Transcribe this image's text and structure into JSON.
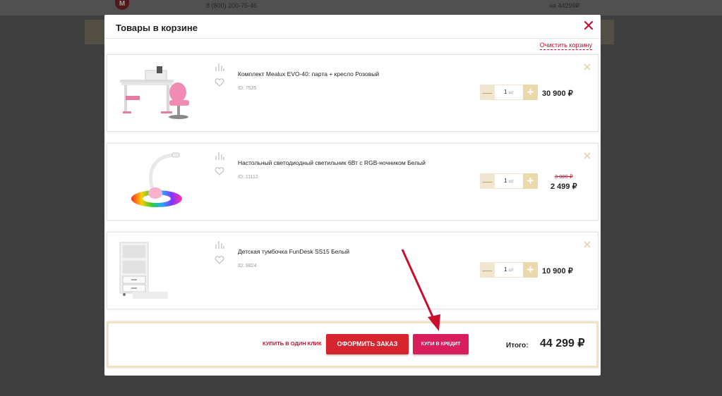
{
  "background": {
    "phone": "8 (800) 200-75-46",
    "cart_total": "на 44299₽"
  },
  "modal": {
    "title": "Товары в корзине",
    "clear_label": "Очистить корзину"
  },
  "items": [
    {
      "name": "Комплект Mealux EVO-40: парта + кресло Розовый",
      "id": "ID: 7535",
      "qty": "1",
      "unit": "шт",
      "price": "30 900 ₽",
      "old_price": ""
    },
    {
      "name": "Настольный светодиодный светильник 6Вт с RGB-ночником Белый",
      "id": "ID: 11112",
      "qty": "1",
      "unit": "шт",
      "price": "2 499 ₽",
      "old_price": "3 000 ₽"
    },
    {
      "name": "Детская тумбочка FunDesk SS15 Белый",
      "id": "ID: 9824",
      "qty": "1",
      "unit": "шт",
      "price": "10 900 ₽",
      "old_price": ""
    }
  ],
  "footer": {
    "one_click_label": "КУПИТЬ В ОДИН КЛИК",
    "checkout_label": "ОФОРМИТЬ ЗАКАЗ",
    "credit_label": "КУПИ В КРЕДИТ",
    "total_label": "Итого:",
    "total_value": "44 299 ₽"
  },
  "colors": {
    "accent_red": "#d6252f",
    "credit_pink": "#d81f5b",
    "qty_beige": "#f0e6cf"
  },
  "icons": [
    "close-icon",
    "compare-icon",
    "favorite-heart-icon",
    "remove-item-icon",
    "minus-icon",
    "plus-icon"
  ]
}
